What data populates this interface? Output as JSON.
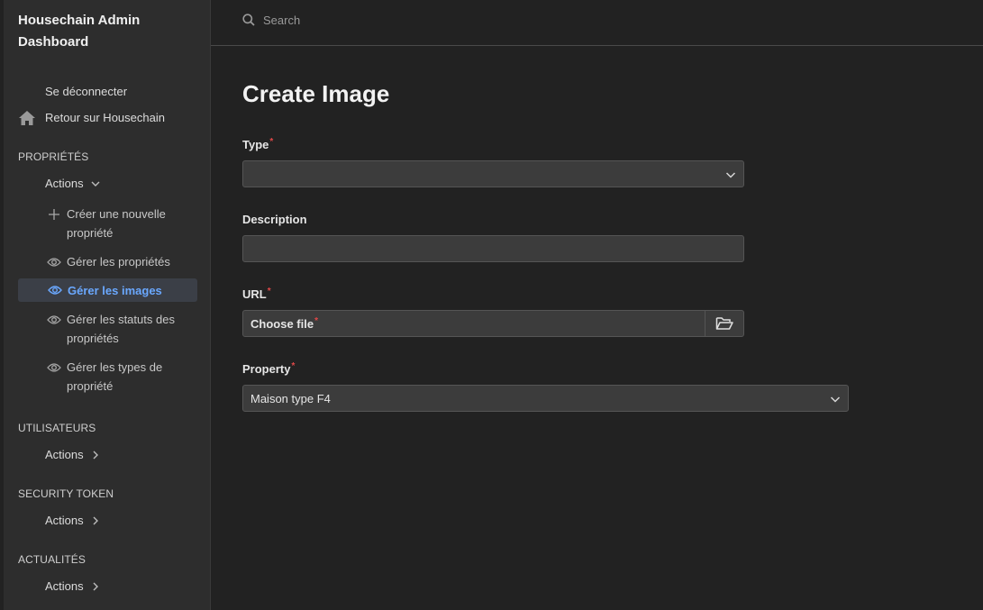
{
  "app": {
    "title": "Housechain Admin Dashboard"
  },
  "sidebar": {
    "logout_label": "Se déconnecter",
    "home_label": "Retour sur Housechain",
    "sections": [
      {
        "title": "PROPRIÉTÉS",
        "actions_label": "Actions",
        "expanded": true,
        "items": [
          {
            "label": "Créer une nouvelle propriété",
            "icon": "plus-icon"
          },
          {
            "label": "Gérer les propriétés",
            "icon": "eye-icon"
          },
          {
            "label": "Gérer les images",
            "icon": "eye-icon",
            "active": true
          },
          {
            "label": "Gérer les statuts des propriétés",
            "icon": "eye-icon"
          },
          {
            "label": "Gérer les types de propriété",
            "icon": "eye-icon"
          }
        ]
      },
      {
        "title": "UTILISATEURS",
        "actions_label": "Actions",
        "expanded": false
      },
      {
        "title": "SECURITY TOKEN",
        "actions_label": "Actions",
        "expanded": false
      },
      {
        "title": "ACTUALITÉS",
        "actions_label": "Actions",
        "expanded": false
      }
    ]
  },
  "topbar": {
    "search_placeholder": "Search"
  },
  "form": {
    "title": "Create Image",
    "required_mark": "*",
    "type": {
      "label": "Type",
      "value": ""
    },
    "description": {
      "label": "Description",
      "value": ""
    },
    "url": {
      "label": "URL",
      "file_label": "Choose file"
    },
    "property": {
      "label": "Property",
      "value": "Maison type F4"
    }
  },
  "colors": {
    "background": "#222222",
    "sidebar": "#2d2d2d",
    "field": "#3c3c3c",
    "accent": "#6aa8ff",
    "required": "#e04848"
  }
}
